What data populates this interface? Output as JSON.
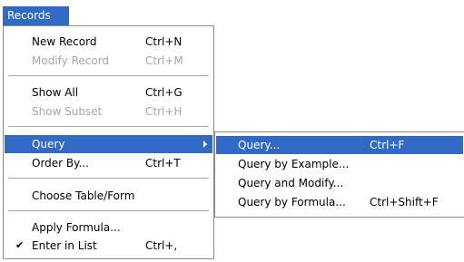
{
  "menubar": {
    "records_label": "Records"
  },
  "menu": {
    "new_record": {
      "label": "New Record",
      "shortcut": "Ctrl+N"
    },
    "modify_record": {
      "label": "Modify Record",
      "shortcut": "Ctrl+M"
    },
    "show_all": {
      "label": "Show All",
      "shortcut": "Ctrl+G"
    },
    "show_subset": {
      "label": "Show Subset",
      "shortcut": "Ctrl+H"
    },
    "query": {
      "label": "Query"
    },
    "order_by": {
      "label": "Order By...",
      "shortcut": "Ctrl+T"
    },
    "choose_table": {
      "label": "Choose Table/Form"
    },
    "apply_formula": {
      "label": "Apply Formula..."
    },
    "enter_in_list": {
      "label": "Enter in List",
      "shortcut": "Ctrl+,"
    }
  },
  "submenu": {
    "query": {
      "label": "Query...",
      "shortcut": "Ctrl+F"
    },
    "query_by_example": {
      "label": "Query by Example..."
    },
    "query_and_modify": {
      "label": "Query and Modify..."
    },
    "query_by_formula": {
      "label": "Query by Formula...",
      "shortcut": "Ctrl+Shift+F"
    }
  },
  "icons": {
    "check": "checkmark-icon",
    "submenu_arrow": "submenu-arrow-icon"
  },
  "colors": {
    "highlight": "#316ac5",
    "disabled": "#a6a6a6"
  }
}
